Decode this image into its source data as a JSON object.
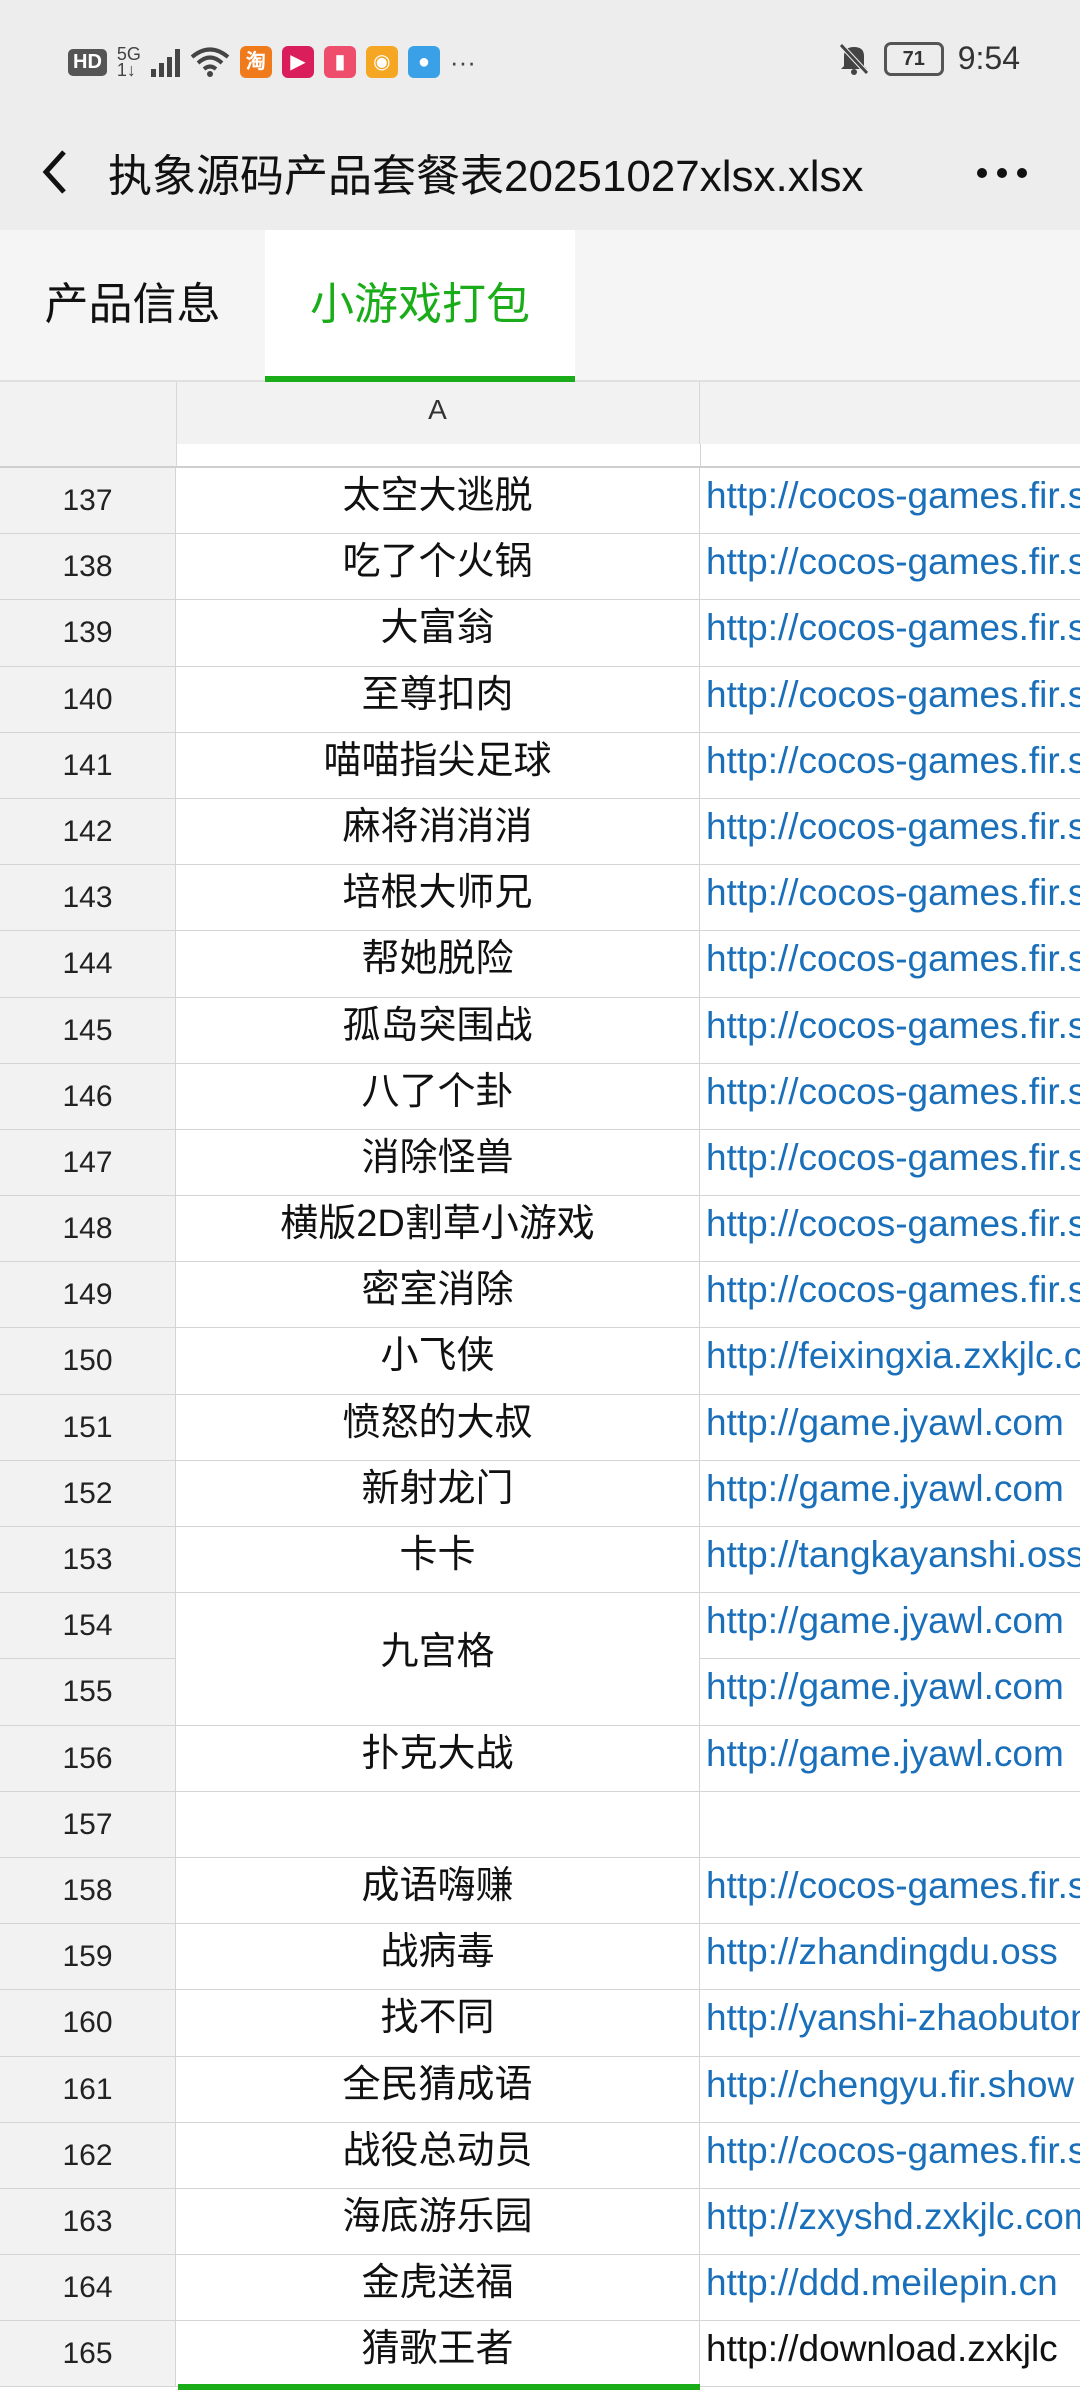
{
  "status": {
    "hd": "HD",
    "net": "5G",
    "net_sub": "1↓",
    "app_taobao": "淘",
    "more": "···",
    "battery": "71",
    "time": "9:54"
  },
  "header": {
    "title": "执象源码产品套餐表20251027xlsx.xlsx"
  },
  "sheets": {
    "tab1": "产品信息",
    "tab2": "小游戏打包"
  },
  "grid": {
    "col_a": "A",
    "rows": [
      {
        "n": "137",
        "a": "太空大逃脱",
        "b": "http://cocos-games.fir.sho"
      },
      {
        "n": "138",
        "a": "吃了个火锅",
        "b": "http://cocos-games.fir.sho"
      },
      {
        "n": "139",
        "a": "大富翁",
        "b": "http://cocos-games.fir.sho"
      },
      {
        "n": "140",
        "a": "至尊扣肉",
        "b": "http://cocos-games.fir.sho"
      },
      {
        "n": "141",
        "a": "喵喵指尖足球",
        "b": "http://cocos-games.fir.sho"
      },
      {
        "n": "142",
        "a": "麻将消消消",
        "b": "http://cocos-games.fir.sho"
      },
      {
        "n": "143",
        "a": "培根大师兄",
        "b": "http://cocos-games.fir.sho"
      },
      {
        "n": "144",
        "a": "帮她脱险",
        "b": "http://cocos-games.fir.sho"
      },
      {
        "n": "145",
        "a": "孤岛突围战",
        "b": "http://cocos-games.fir.sho"
      },
      {
        "n": "146",
        "a": "八了个卦",
        "b": "http://cocos-games.fir.sho"
      },
      {
        "n": "147",
        "a": "消除怪兽",
        "b": "http://cocos-games.fir.sho"
      },
      {
        "n": "148",
        "a": "横版2D割草小游戏",
        "b": "http://cocos-games.fir.sho"
      },
      {
        "n": "149",
        "a": "密室消除",
        "b": "http://cocos-games.fir.sho"
      },
      {
        "n": "150",
        "a": "小飞侠",
        "b": "http://feixingxia.zxkjlc.com"
      },
      {
        "n": "151",
        "a": "愤怒的大叔",
        "b": "http://game.jyawl.com"
      },
      {
        "n": "152",
        "a": "新射龙门",
        "b": "http://game.jyawl.com"
      },
      {
        "n": "153",
        "a": "卡卡",
        "b": "http://tangkayanshi.oss"
      },
      {
        "n": "154",
        "a": "",
        "b": "http://game.jyawl.com"
      },
      {
        "n": "155",
        "a": "",
        "b": "http://game.jyawl.com"
      },
      {
        "n": "156",
        "a": "扑克大战",
        "b": "http://game.jyawl.com"
      },
      {
        "n": "157",
        "a": "",
        "b": ""
      },
      {
        "n": "158",
        "a": "成语嗨赚",
        "b": "http://cocos-games.fir.sho"
      },
      {
        "n": "159",
        "a": "战病毒",
        "b": "http://zhandingdu.oss"
      },
      {
        "n": "160",
        "a": "找不同",
        "b": "http://yanshi-zhaobutong"
      },
      {
        "n": "161",
        "a": "全民猜成语",
        "b": "http://chengyu.fir.show"
      },
      {
        "n": "162",
        "a": "战役总动员",
        "b": "http://cocos-games.fir.sho"
      },
      {
        "n": "163",
        "a": "海底游乐园",
        "b": "http://zxyshd.zxkjlc.com"
      },
      {
        "n": "164",
        "a": "金虎送福",
        "b": "http://ddd.meilepin.cn"
      },
      {
        "n": "165",
        "a": "猜歌王者",
        "b": "http://download.zxkjlc"
      }
    ],
    "merged_154_155": "九宫格"
  }
}
